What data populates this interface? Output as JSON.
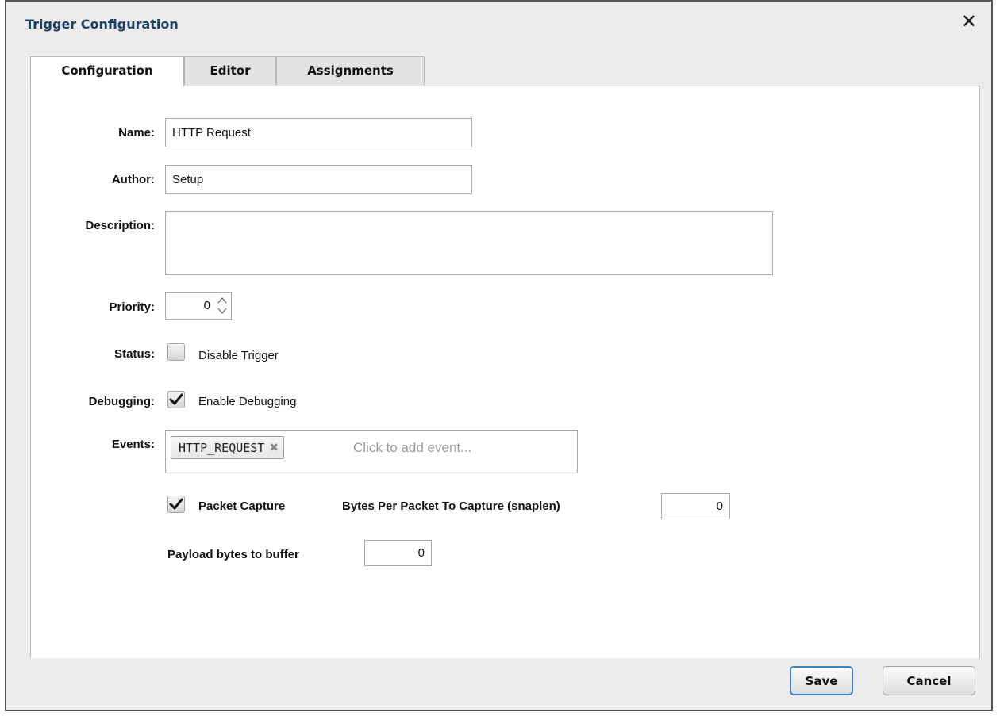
{
  "dialog": {
    "title": "Trigger Configuration",
    "close_label": "✕"
  },
  "tabs": [
    {
      "label": "Configuration",
      "active": true
    },
    {
      "label": "Editor",
      "active": false
    },
    {
      "label": "Assignments",
      "active": false
    }
  ],
  "form": {
    "name": {
      "label": "Name:",
      "value": "HTTP Request"
    },
    "author": {
      "label": "Author:",
      "value": "Setup"
    },
    "description": {
      "label": "Description:",
      "value": ""
    },
    "priority": {
      "label": "Priority:",
      "value": "0"
    },
    "status": {
      "label": "Status:",
      "checkbox_label": "Disable Trigger",
      "checked": false
    },
    "debugging": {
      "label": "Debugging:",
      "checkbox_label": "Enable Debugging",
      "checked": true
    },
    "events": {
      "label": "Events:",
      "tokens": [
        "HTTP_REQUEST"
      ],
      "placeholder": "Click to add event..."
    },
    "packet_capture": {
      "checkbox_label": "Packet Capture",
      "checked": true
    },
    "snaplen": {
      "label": "Bytes Per Packet To Capture (snaplen)",
      "value": "0"
    },
    "payload": {
      "label": "Payload bytes to buffer",
      "value": "0"
    }
  },
  "buttons": {
    "save": "Save",
    "cancel": "Cancel"
  },
  "colors": {
    "title": "#1c3f66",
    "save_border": "#3b83c6",
    "dialog_bg": "#ececec"
  }
}
